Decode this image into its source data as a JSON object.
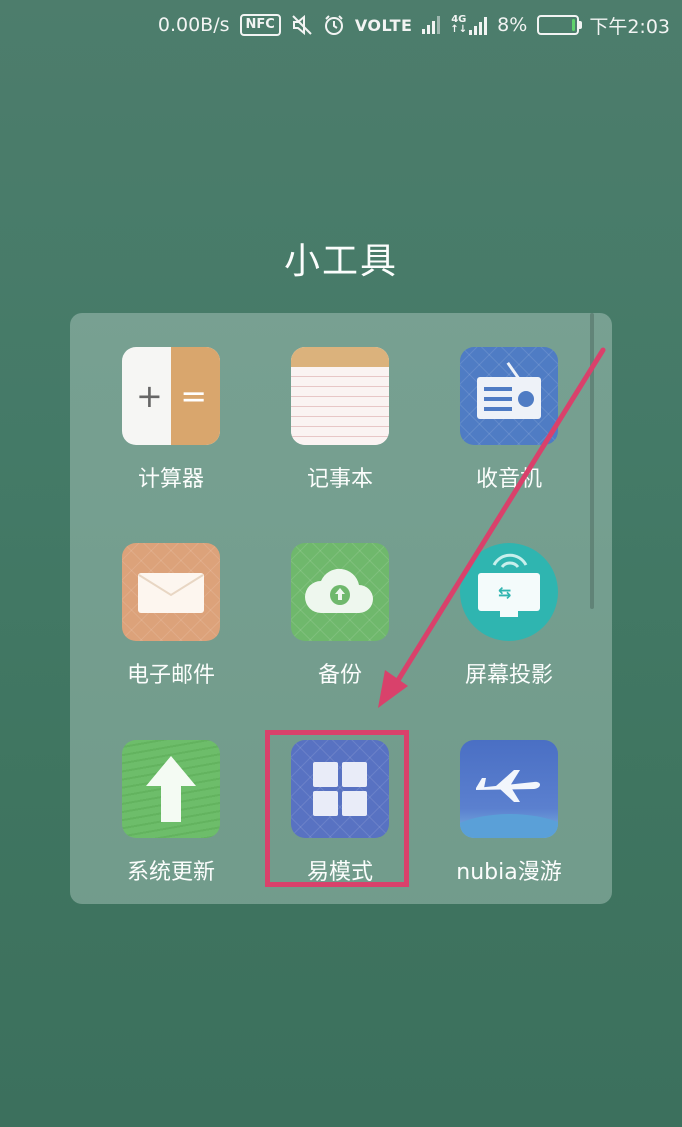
{
  "status_bar": {
    "speed": "0.00B/s",
    "nfc": "NFC",
    "volte": "VOLTE",
    "network": "4G",
    "battery": "8%",
    "battery_level": 0.08,
    "time": "下午2:03"
  },
  "folder": {
    "title": "小工具",
    "apps": [
      {
        "label": "计算器",
        "icon": "calculator-icon"
      },
      {
        "label": "记事本",
        "icon": "notepad-icon"
      },
      {
        "label": "收音机",
        "icon": "radio-icon"
      },
      {
        "label": "电子邮件",
        "icon": "email-icon"
      },
      {
        "label": "备份",
        "icon": "cloud-backup-icon"
      },
      {
        "label": "屏幕投影",
        "icon": "screen-cast-icon"
      },
      {
        "label": "系统更新",
        "icon": "system-update-icon"
      },
      {
        "label": "易模式",
        "icon": "easy-mode-icon"
      },
      {
        "label": "nubia漫游",
        "icon": "roaming-airplane-icon"
      }
    ]
  },
  "annotation": {
    "color": "#d9416b"
  }
}
